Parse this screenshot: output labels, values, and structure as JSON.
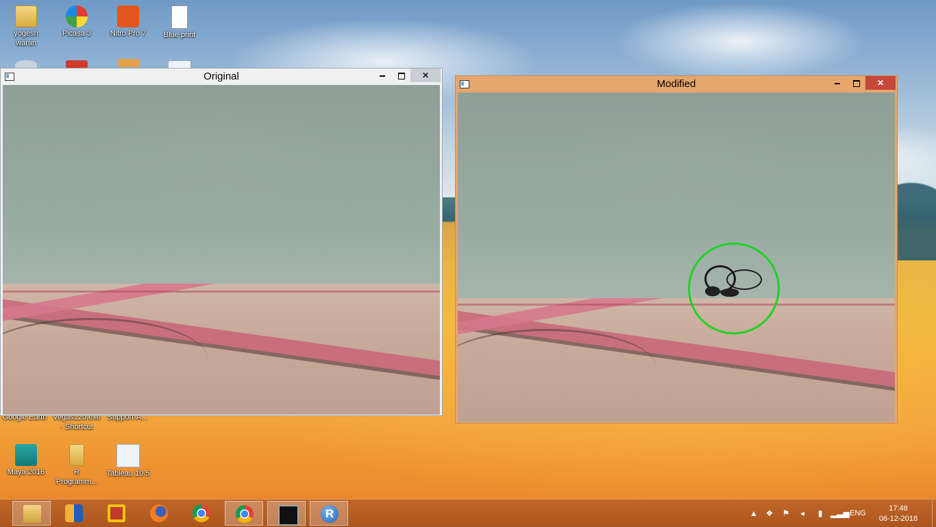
{
  "desktop": {
    "icons": [
      {
        "label": "yogesh\nwaran"
      },
      {
        "label": "Picasa 3"
      },
      {
        "label": "Nitro Pro 7"
      },
      {
        "label": "Blue print"
      },
      {
        "label": "Google Earth"
      },
      {
        "label": "Vegas120.exe\n- Shortcut"
      },
      {
        "label": "Support-A..."
      },
      {
        "label": "Maya 2016"
      },
      {
        "label": "R\nProgramm..."
      },
      {
        "label": "Tableau 10.5"
      }
    ]
  },
  "windows": {
    "original": {
      "title": "Original",
      "min_label": "minimize",
      "max_label": "maximize",
      "close_label": "✕"
    },
    "modified": {
      "title": "Modified",
      "min_label": "minimize",
      "max_label": "maximize",
      "close_label": "✕"
    }
  },
  "taskbar": {
    "apps": [
      {
        "name": "File Explorer",
        "icon": "folder-icon"
      },
      {
        "name": "Vegas",
        "icon": "vegas-icon"
      },
      {
        "name": "Slideshow",
        "icon": "slides-icon"
      },
      {
        "name": "Firefox",
        "icon": "firefox-icon"
      },
      {
        "name": "Chrome",
        "icon": "chrome-icon"
      },
      {
        "name": "Chrome",
        "icon": "chrome-icon"
      },
      {
        "name": "Command Prompt",
        "icon": "cmd-icon"
      },
      {
        "name": "R",
        "icon": "r-icon",
        "glyph": "R"
      }
    ],
    "tray": {
      "language": "ENG",
      "time": "17:48",
      "date": "06-12-2018"
    }
  },
  "colors": {
    "accent_modified_titlebar": "#e7a66b",
    "close_button": "#c7473b",
    "detection_circle": "#1ed31e"
  }
}
